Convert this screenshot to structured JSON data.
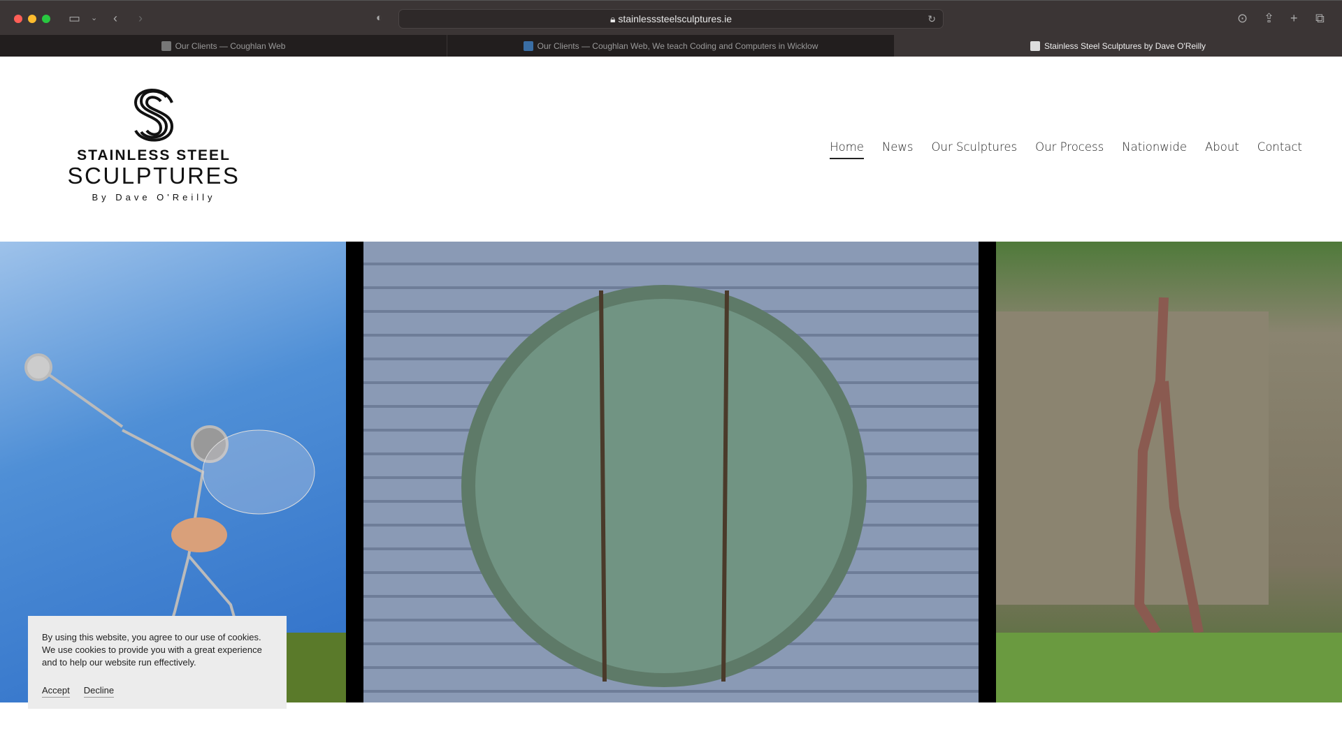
{
  "browser": {
    "url": "stainlesssteelsculptures.ie",
    "tabs": [
      {
        "label": "Our Clients — Coughlan Web",
        "active": false
      },
      {
        "label": "Our Clients — Coughlan Web, We teach Coding and Computers in Wicklow",
        "active": false
      },
      {
        "label": "Stainless Steel Sculptures by Dave O'Reilly",
        "active": true
      }
    ]
  },
  "logo": {
    "line1": "STAINLESS STEEL",
    "line2": "SCULPTURES",
    "line3": "By Dave O'Reilly"
  },
  "nav": {
    "items": [
      "Home",
      "News",
      "Our Sculptures",
      "Our Process",
      "Nationwide",
      "About",
      "Contact"
    ],
    "active": "Home"
  },
  "gallery": [
    "fairy-wire-sculpture",
    "bronze-circular-relief",
    "standing-figure-sculpture"
  ],
  "cookie": {
    "text": "By using this website, you agree to our use of cookies. We use cookies to provide you with a great experience and to help our website run effectively.",
    "accept": "Accept",
    "decline": "Decline"
  }
}
